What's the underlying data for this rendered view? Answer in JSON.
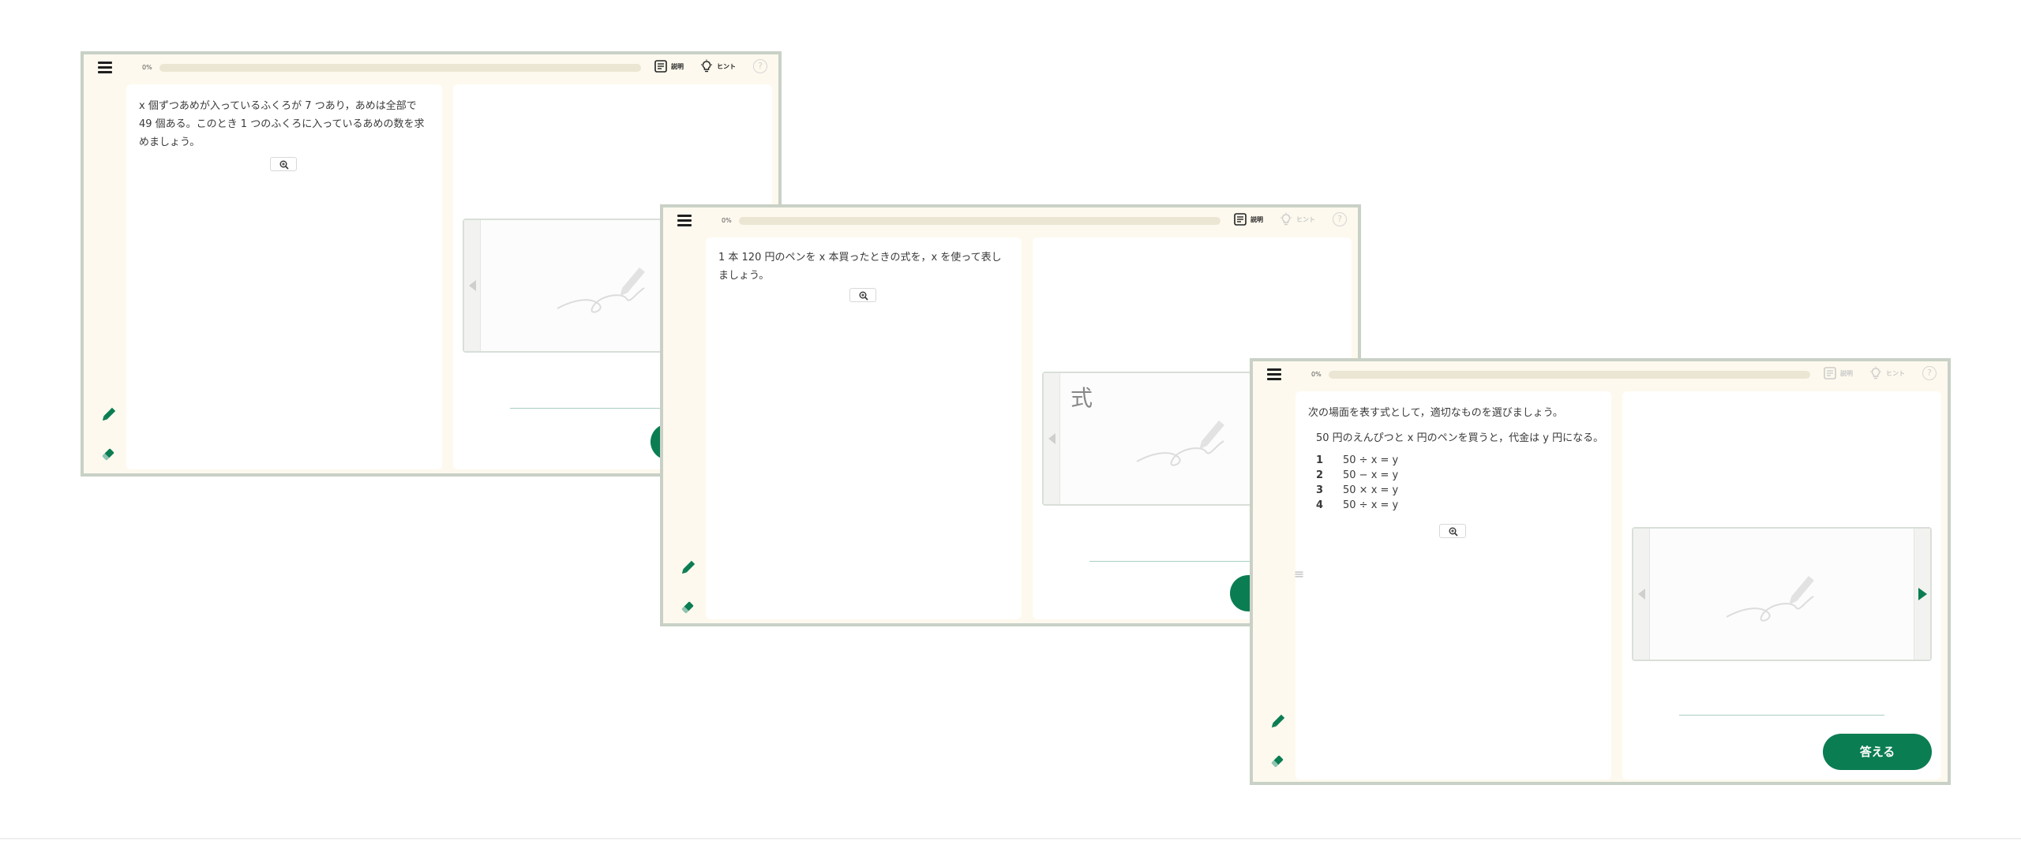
{
  "colors": {
    "accent": "#0b7d52",
    "frame": "#c9d1c6",
    "bg": "#fdf9ee"
  },
  "windows": [
    {
      "progress_label": "0%",
      "progress": 0,
      "explain_label": "説明",
      "hint_label": "ヒント",
      "question": {
        "lines": [
          "x 個ずつあめが入っているふくろが 7 つあり，あめは全部で",
          "49 個ある。このとき 1 つのふくろに入っているあめの数を求",
          "めましょう。"
        ]
      }
    },
    {
      "progress_label": "0%",
      "progress": 0,
      "explain_label": "説明",
      "hint_label": "ヒント",
      "question": {
        "lines": [
          "1 本 120 円のペンを x 本買ったときの式を，x を使って表し",
          "ましょう。"
        ]
      },
      "pad_label": "式"
    },
    {
      "progress_label": "0%",
      "progress": 0,
      "explain_label": "説明",
      "hint_label": "ヒント",
      "question": {
        "lines": [
          "次の場面を表す式として，適切なものを選びましょう。"
        ]
      },
      "scene": "50 円のえんぴつと x 円のペンを買うと，代金は y 円になる。",
      "choices": [
        {
          "num": "1",
          "expr": "50 ÷ x = y"
        },
        {
          "num": "2",
          "expr": "50 − x = y"
        },
        {
          "num": "3",
          "expr": "50 × x = y"
        },
        {
          "num": "4",
          "expr": "50 ÷ x = y"
        }
      ],
      "answer_label": "答える"
    }
  ]
}
